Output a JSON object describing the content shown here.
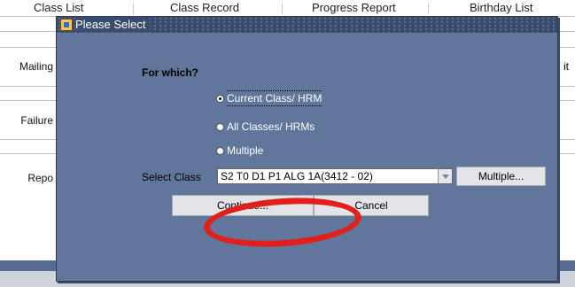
{
  "background": {
    "tabs": [
      "Class List",
      "Class Record",
      "Progress Report",
      "Birthday List"
    ],
    "side_labels": [
      "Mailing",
      "Failure",
      "Repo"
    ],
    "right_fragment": "it"
  },
  "dialog": {
    "title": "Please Select",
    "question": "For which?",
    "options": [
      {
        "label": "Current Class/ HRM",
        "checked": true
      },
      {
        "label": "All Classes/ HRMs",
        "checked": false
      },
      {
        "label": "Multiple",
        "checked": false
      }
    ],
    "select_class_label": "Select Class",
    "select_class_value": "S2 T0 D1 P1 ALG 1A(3412 - 02)",
    "multiple_button": "Multiple...",
    "continue_button": "Continue...",
    "cancel_button": "Cancel"
  },
  "colors": {
    "dialog_bg": "#60769a",
    "titlebar_bg": "#3a4c6e",
    "annotation": "#e1201c"
  }
}
